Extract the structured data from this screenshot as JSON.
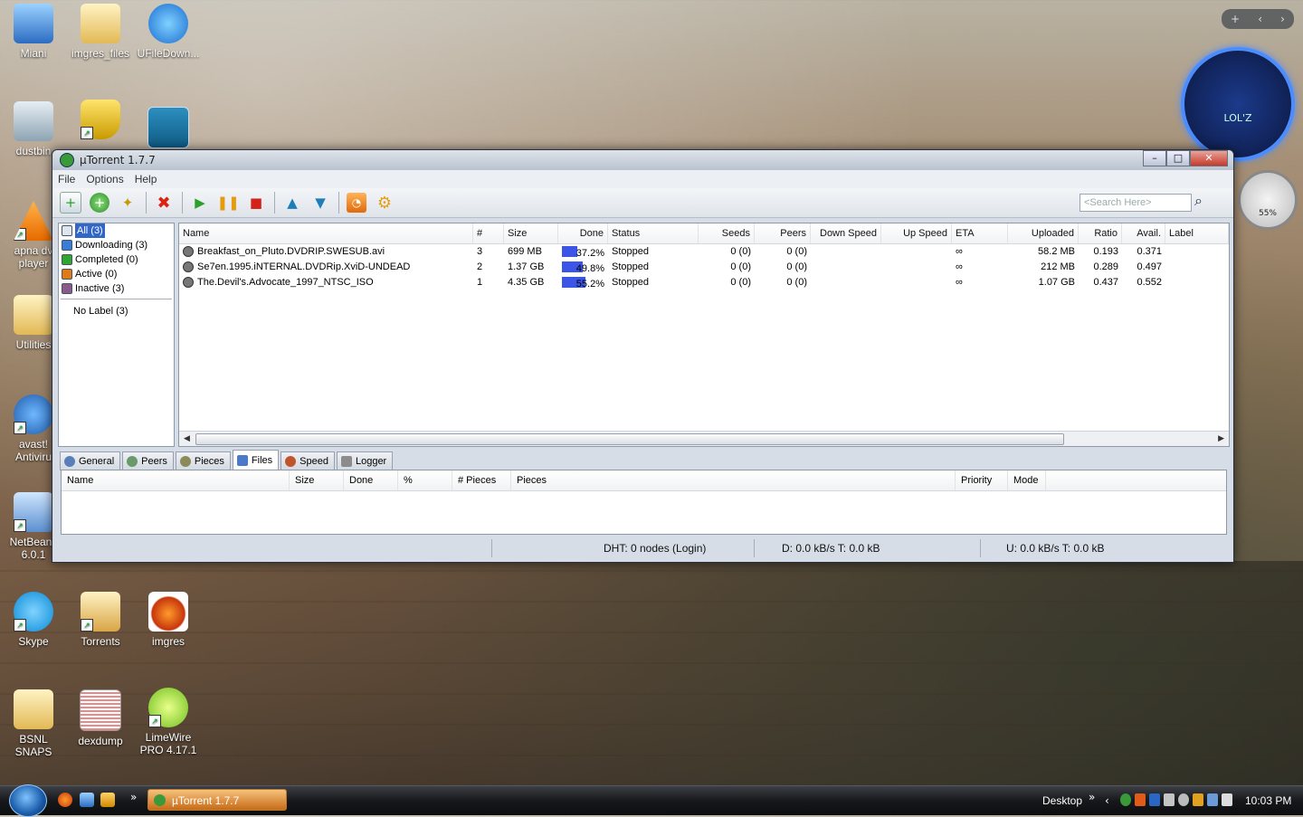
{
  "desktop": {
    "icons": [
      {
        "label": "Miani"
      },
      {
        "label": "imgres_files"
      },
      {
        "label": "UFileDown..."
      },
      {
        "label": "dustbin"
      },
      {
        "label": "apna dv player"
      },
      {
        "label": "Utilities"
      },
      {
        "label": "avast! Antiviru"
      },
      {
        "label": "NetBeans 6.0.1"
      },
      {
        "label": "Skype"
      },
      {
        "label": "Torrents"
      },
      {
        "label": "imgres"
      },
      {
        "label": "BSNL SNAPS"
      },
      {
        "label": "dexdump"
      },
      {
        "label": "LimeWire PRO 4.17.1"
      }
    ],
    "gadgets": {
      "clock_label": "LOL'Z",
      "meter_label": "55%",
      "bar_symbols": [
        "+",
        "‹",
        "›"
      ]
    }
  },
  "window": {
    "title": "µTorrent 1.7.7",
    "menu": [
      "File",
      "Options",
      "Help"
    ],
    "search_placeholder": "<Search Here>",
    "categories": [
      {
        "label": "All (3)",
        "selected": true
      },
      {
        "label": "Downloading (3)"
      },
      {
        "label": "Completed (0)"
      },
      {
        "label": "Active (0)"
      },
      {
        "label": "Inactive (3)"
      }
    ],
    "labels": [
      {
        "label": "No Label (3)"
      }
    ],
    "columns": [
      "Name",
      "#",
      "Size",
      "Done",
      "Status",
      "Seeds",
      "Peers",
      "Down Speed",
      "Up Speed",
      "ETA",
      "Uploaded",
      "Ratio",
      "Avail.",
      "Label"
    ],
    "torrents": [
      {
        "name": "Breakfast_on_Pluto.DVDRIP.SWESUB.avi",
        "num": "3",
        "size": "699 MB",
        "done": "37.2%",
        "done_value": 37.2,
        "status": "Stopped",
        "seeds": "0 (0)",
        "peers": "0 (0)",
        "down": "",
        "up": "",
        "eta": "∞",
        "uploaded": "58.2 MB",
        "ratio": "0.193",
        "avail": "0.371",
        "label": ""
      },
      {
        "name": "Se7en.1995.iNTERNAL.DVDRip.XviD-UNDEAD",
        "num": "2",
        "size": "1.37 GB",
        "done": "49.8%",
        "done_value": 49.8,
        "status": "Stopped",
        "seeds": "0 (0)",
        "peers": "0 (0)",
        "down": "",
        "up": "",
        "eta": "∞",
        "uploaded": "212 MB",
        "ratio": "0.289",
        "avail": "0.497",
        "label": ""
      },
      {
        "name": "The.Devil's.Advocate_1997_NTSC_ISO",
        "num": "1",
        "size": "4.35 GB",
        "done": "55.2%",
        "done_value": 55.2,
        "status": "Stopped",
        "seeds": "0 (0)",
        "peers": "0 (0)",
        "down": "",
        "up": "",
        "eta": "∞",
        "uploaded": "1.07 GB",
        "ratio": "0.437",
        "avail": "0.552",
        "label": ""
      }
    ],
    "tabs": [
      {
        "label": "General"
      },
      {
        "label": "Peers"
      },
      {
        "label": "Pieces"
      },
      {
        "label": "Files",
        "active": true
      },
      {
        "label": "Speed"
      },
      {
        "label": "Logger"
      }
    ],
    "file_columns": [
      "Name",
      "Size",
      "Done",
      "%",
      "# Pieces",
      "Pieces",
      "Priority",
      "Mode"
    ],
    "status": {
      "dht": "DHT: 0 nodes (Login)",
      "download": "D: 0.0 kB/s T: 0.0 kB",
      "upload": "U: 0.0 kB/s T: 0.0 kB"
    }
  },
  "taskbar": {
    "task_label": "µTorrent 1.7.7",
    "desktop_label": "Desktop",
    "time": "10:03 PM",
    "overflow": "»",
    "tray_arrow": "‹"
  }
}
